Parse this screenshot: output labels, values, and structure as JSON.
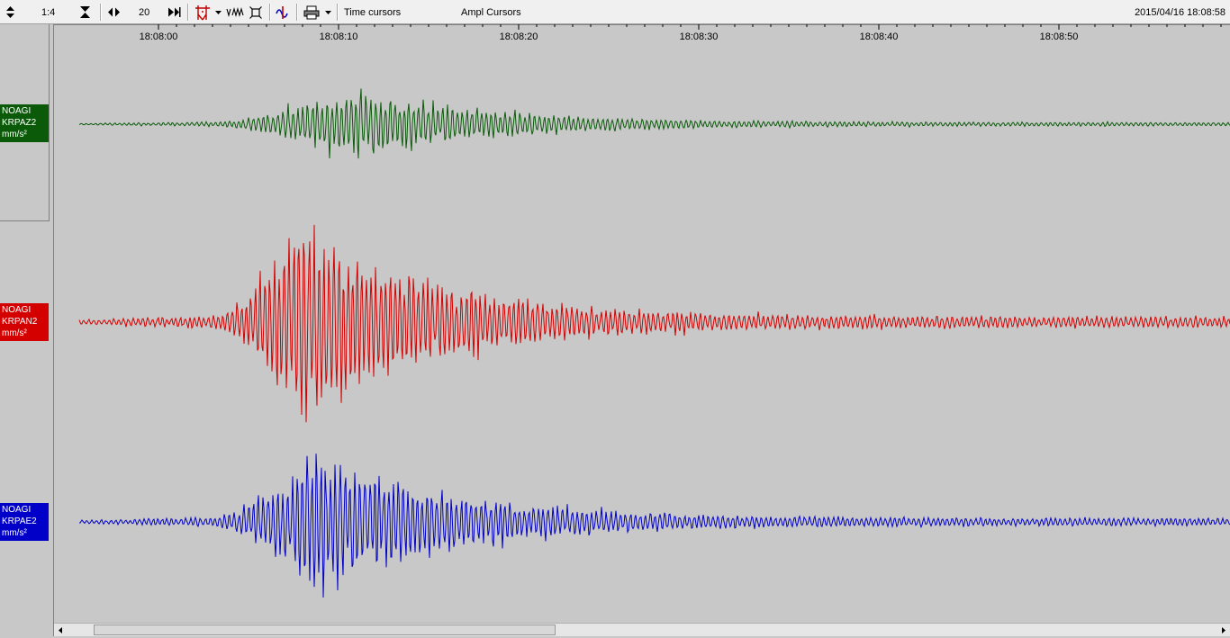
{
  "toolbar": {
    "zoom_ratio": "1:4",
    "span_value": "20",
    "time_cursors_label": "Time cursors",
    "ampl_cursors_label": "Ampl Cursors",
    "datetime": "2015/04/16 18:08:58"
  },
  "time_axis": {
    "tick_labels": [
      "18:08:00",
      "18:08:10",
      "18:08:20",
      "18:08:30",
      "18:08:40",
      "18:08:50"
    ]
  },
  "channels": [
    {
      "network": "NOAGI",
      "station": "KRPAZ2",
      "unit": "mm/s²",
      "color": "#0a5a0a",
      "relative_amplitude": 0.35,
      "peak_offset_s": 3
    },
    {
      "network": "NOAGI",
      "station": "KRPAN2",
      "unit": "mm/s²",
      "color": "#d40000",
      "relative_amplitude": 1.0,
      "peak_offset_s": 0
    },
    {
      "network": "NOAGI",
      "station": "KRPAE2",
      "unit": "mm/s²",
      "color": "#0000c8",
      "relative_amplitude": 0.72,
      "peak_offset_s": 1
    }
  ],
  "icons": {
    "scale_arrows": "vertical-scale-icon",
    "expand": "expand-vertical-icon",
    "time_nav": "time-nav-icon",
    "goto_end": "goto-end-icon",
    "picks": "picks-icon",
    "filter": "filter-icon",
    "zoom_box": "zoom-box-icon",
    "spectrum": "spectrum-icon",
    "print": "print-icon"
  }
}
